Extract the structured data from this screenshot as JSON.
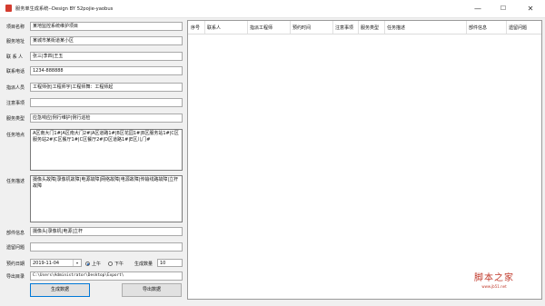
{
  "window": {
    "title": "服务单生成系统--Design BY 52pojie-yaobus",
    "controls": {
      "minimize": "—",
      "maximize": "☐",
      "close": "✕"
    }
  },
  "form": {
    "project_name": {
      "label": "项目名称",
      "value": "某地监控系统维护项目"
    },
    "service_address": {
      "label": "服务地址",
      "value": "某城市某街道某小区"
    },
    "contact": {
      "label": "联 系 人",
      "value": "张三|李四|王五"
    },
    "phone": {
      "label": "联系电话",
      "value": "1234-888888"
    },
    "engineer": {
      "label": "指派人员",
      "value": "工程师张|工程师宇|工程师舞：工程师起"
    },
    "notes": {
      "label": "注意事项",
      "value": ""
    },
    "service_type": {
      "label": "服务类型",
      "value": "应急响应|例行维护|例行巡检"
    },
    "task_location": {
      "label": "任务地点",
      "value": "A区南大门1#|A区南大门2#|A区道路1#|B区花园1#|B区服务站1#|C区服务站2#|C区餐厅1#|C区餐厅2#|D区道路1#|E区儿门#"
    },
    "task_desc": {
      "label": "任务描述",
      "value": "摄像头故障|录像机故障|电源故障|网络故障|电源故障|传输线路故障|立杆故障"
    },
    "parts": {
      "label": "部件信息",
      "value": "摄像头|录像机|电源|立杆"
    },
    "remaining": {
      "label": "遗留问题",
      "value": ""
    },
    "date": {
      "label": "预约日期",
      "value": "2019-11-04",
      "dropdown": "▾"
    },
    "am": {
      "label": "上午",
      "selected": true
    },
    "pm": {
      "label": "下午",
      "selected": false
    },
    "count": {
      "label": "生成数量",
      "value": "10"
    },
    "export_dir": {
      "label": "导出目录",
      "value": "C:\\Users\\Administrator\\Desktop\\Export\\"
    },
    "generate_button": "生成数据",
    "export_button": "导出数据"
  },
  "grid": {
    "columns": [
      "序号",
      "联系人",
      "指派工程师",
      "预约时间",
      "注意事项",
      "服务类型",
      "任务描述",
      "部件信息",
      "遗留问题"
    ]
  },
  "watermark": {
    "text": "脚本之家",
    "url": "www.jb51.net"
  },
  "colors": {
    "accent": "#0078d7",
    "watermark": "#c0392b",
    "icon": "#d43c2f"
  }
}
